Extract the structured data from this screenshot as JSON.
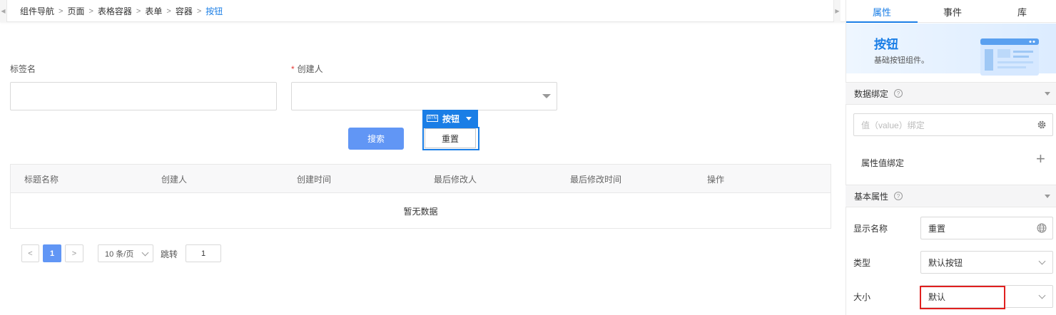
{
  "breadcrumb": {
    "items": [
      "组件导航",
      "页面",
      "表格容器",
      "表单",
      "容器"
    ],
    "current": "按钮"
  },
  "form": {
    "field1_label": "标签名",
    "field2_label": "创建人",
    "required_mark": "*",
    "search_button": "搜索",
    "reset_button": "重置"
  },
  "selection": {
    "tag_icon": "BTN",
    "tag_label": "按钮"
  },
  "table": {
    "columns": [
      "标题名称",
      "创建人",
      "创建时间",
      "最后修改人",
      "最后修改时间",
      "操作"
    ],
    "empty_text": "暂无数据"
  },
  "pagination": {
    "prev": "<",
    "current_page": "1",
    "next": ">",
    "page_size": "10 条/页",
    "jump_label": "跳转",
    "jump_value": "1"
  },
  "panel": {
    "tabs": [
      "属性",
      "事件",
      "库"
    ],
    "active_tab": "属性",
    "hero_title": "按钮",
    "hero_subtitle": "基础按钮组件。",
    "data_binding": {
      "title": "数据绑定",
      "value_placeholder": "值（value）绑定",
      "attr_binding_label": "属性值绑定",
      "add_symbol": "+"
    },
    "basic": {
      "title": "基本属性",
      "display_name_label": "显示名称",
      "display_name_value": "重置",
      "type_label": "类型",
      "type_value": "默认按钮",
      "size_label": "大小",
      "size_value": "默认"
    }
  },
  "colors": {
    "accent": "#1a7ee6",
    "primary_button": "#6196f5",
    "required": "#e53935",
    "highlight_border": "#e0201f"
  }
}
